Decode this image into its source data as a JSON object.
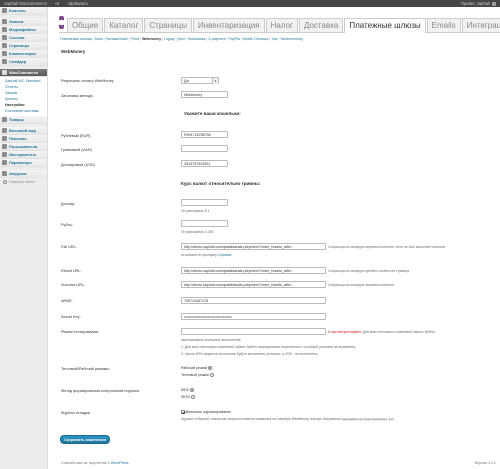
{
  "adminbar": {
    "site": "Saphali Woocommerce",
    "comments": "0",
    "add_new": "Добавить",
    "greeting": "Привет, saphali"
  },
  "sidebar": {
    "items": [
      {
        "label": "Консоль"
      },
      {
        "label": "Записи"
      },
      {
        "label": "Медиафайлы"
      },
      {
        "label": "Ссылки"
      },
      {
        "label": "Страницы"
      },
      {
        "label": "Комментарии"
      },
      {
        "label": "Слайдер"
      },
      {
        "label": "WooCommerce"
      },
      {
        "label": "Товары"
      },
      {
        "label": "Внешний вид"
      },
      {
        "label": "Плагины"
      },
      {
        "label": "Пользователи"
      },
      {
        "label": "Инструменты"
      },
      {
        "label": "Параметры"
      },
      {
        "label": "Загрузки"
      }
    ],
    "submenu": [
      "Saphali WC Standard",
      "Отчеты",
      "Заказы",
      "Купоны",
      "Настройки",
      "Состояние системы"
    ],
    "collapse": "Свернуть меню"
  },
  "tabs": [
    "Общие",
    "Каталог",
    "Страницы",
    "Инвентаризация",
    "Налог",
    "Доставка",
    "Платежные шлюзы",
    "Emails",
    "Интеграция"
  ],
  "subsub": [
    "Платежные шлюзы",
    "Банк",
    "Наложенный",
    "Ptrnd",
    "Webmoney",
    "Liqpay",
    "Qiwi",
    "Robokassa",
    "Z-payment",
    "PayPal",
    "Mobill Checkout",
    "Yas",
    "Yandexmoney"
  ],
  "form": {
    "heading": "WebMoney",
    "enable": {
      "label": "Разрешить оплату WebMoney",
      "value": "Да"
    },
    "title": {
      "label": "Заголовок метода",
      "value": "WebMoney"
    },
    "wallets_heading": "Укажите ваши кошельки:",
    "rub": {
      "label": "Рублевый (RUR)",
      "value": "R591718786756"
    },
    "uah": {
      "label": "Гривневый (UAH)",
      "value": ""
    },
    "usd": {
      "label": "Долларовый (USD)",
      "value": "Z815797424091"
    },
    "rates_heading": "Курс валют относительно гривны:",
    "usd_rate": {
      "label": "Доллар:",
      "value": "",
      "desc": "По умолчанию 8.1"
    },
    "rub_rate": {
      "label": "Рубль:",
      "value": "",
      "desc": "По умолчанию 0.245"
    },
    "fail_url": {
      "label": "Fail URL:",
      "value": "http://demo.saphali.com/qiwtaldaraai-polychen/?order_results_with=",
      "desc1": "Страница на которую вернется клиент, если не был выполнен платеж",
      "desc2": "по-кнопке по принципу",
      "desc_link": "Справка"
    },
    "result_url": {
      "label": "Result URL:",
      "value": "http://demo.saphali.com/qiwtaldaraai-polychen/?order_results_with=",
      "desc": "Страница на которую придет ответ от сервера"
    },
    "success_url": {
      "label": "Success URL:",
      "value": "http://demo.saphali.com/qiwtaldaraai-polychen/?order_results_with=",
      "desc": "Страница на которую вернется клиент."
    },
    "wmid": {
      "label": "WMID:",
      "value": "739710387278"
    },
    "secret": {
      "label": "Secret Key:",
      "value": "••••••••••••••••••••••••••••••••••••••"
    },
    "test_mode": {
      "label": "Режим тестирования:",
      "value": "",
      "desc_red": "0 или отсутствует:",
      "desc1": "Для всех тестовых платежей сервис будет",
      "desc2": "имитировать успешное выполнение;",
      "desc3": "1: Для всех тестовых платежей сервис будет имитировать выполнение с ошибкой (платеж не выполнен);",
      "desc4": "2: Около 80% запросов на платеж будут выполнены успешно, а 20% - не выполнены."
    },
    "mode": {
      "label": "Тестовый/Рабочий режимы:",
      "opt1": "Рабочий режим",
      "opt2": "Тестовый режим"
    },
    "sign": {
      "label": "Метод формирования контрольной подписи:",
      "opt1": "MD5",
      "opt2": "SIGN"
    },
    "log": {
      "label": "Журнал отладки",
      "check": "Включить журналирование",
      "desc": "Журнал событий, такие как запросы/ответы магазина от сервера WebMoney, внутри документа",
      "code": "woocommerce/logs/webmoney.txt"
    },
    "save": "Сохранить изменения"
  },
  "footer": {
    "left": "Спасибо вам за творчество с",
    "link": "WordPress",
    "right": "Версия 3.4.2"
  }
}
